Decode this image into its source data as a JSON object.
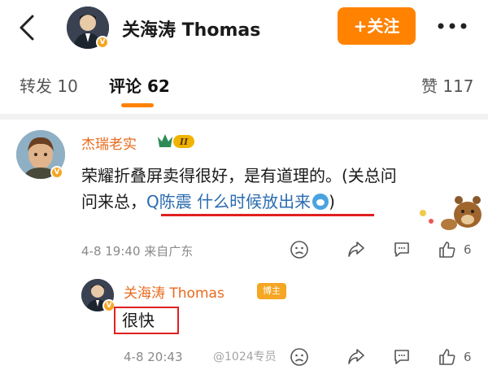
{
  "header": {
    "title": "关海涛 Thomas",
    "follow_label": "+关注"
  },
  "tabs": {
    "repost": "转发 10",
    "comments": "评论 62",
    "likes": "赞 117"
  },
  "comment": {
    "author": "杰瑞老实",
    "level_badge": "II",
    "text_line1": "荣耀折叠屏卖得很好，是有道理的。(关总问",
    "text_line2_prefix": "问来总，",
    "search_link": "Q陈震 什么时候放出来",
    "text_line2_suffix": ")",
    "meta": "4-8 19:40 来自广东",
    "like_count": "6"
  },
  "reply": {
    "author": "关海涛 Thomas",
    "badge": "博主",
    "text": "很快",
    "meta": "4-8 20:43",
    "like_count": "6"
  },
  "watermark": "@1024专员",
  "colors": {
    "accent": "#ff8200",
    "name": "#e86a1c",
    "link": "#2b6cb0",
    "highlight": "#e02020"
  }
}
